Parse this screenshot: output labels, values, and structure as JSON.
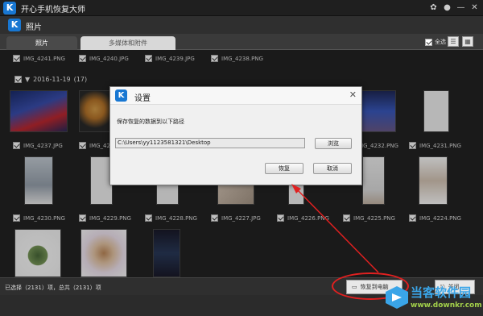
{
  "app": {
    "title": "开心手机恢复大师",
    "logo_letter": "K"
  },
  "window_controls": [
    "wechat-icon",
    "chat-icon",
    "minimize-icon",
    "close-icon"
  ],
  "section": {
    "title": "照片",
    "logo_letter": "K"
  },
  "tabs": [
    {
      "label": "照片",
      "active": true
    },
    {
      "label": "多媒体和附件",
      "active": false
    }
  ],
  "toolbar": {
    "select_all_label": "全选",
    "select_all_checked": true
  },
  "rows": [
    {
      "files": [
        "IMG_4241.PNG",
        "IMG_4240.JPG",
        "IMG_4239.JPG",
        "IMG_4238.PNG"
      ]
    }
  ],
  "group": {
    "date": "2016-11-19",
    "count": "(17)"
  },
  "row2_files": [
    "IMG_4237.JPG",
    "IMG_423",
    "IMG_4232.PNG",
    "IMG_4231.PNG"
  ],
  "row3_files": [
    "IMG_4230.PNG",
    "IMG_4229.PNG",
    "IMG_4228.PNG",
    "IMG_4227.JPG",
    "IMG_4226.PNG",
    "IMG_4225.PNG",
    "IMG_4224.PNG"
  ],
  "dialog": {
    "logo_letter": "K",
    "title": "设置",
    "prompt": "保存恢复的数据到以下路径",
    "path": "C:\\Users\\yy1123581321\\Desktop",
    "browse_label": "浏览",
    "restore_label": "恢复",
    "cancel_label": "取消",
    "close_glyph": "✕"
  },
  "status": {
    "text": "已选择（2131）项，总共（2131）项",
    "restore_button": "恢复到电脑",
    "export_button": "关闭"
  },
  "watermark": {
    "brand": "当客软件园",
    "url": "www.downkr.com"
  },
  "colors": {
    "brand_blue": "#1877d2",
    "callout_red": "#e02020"
  }
}
